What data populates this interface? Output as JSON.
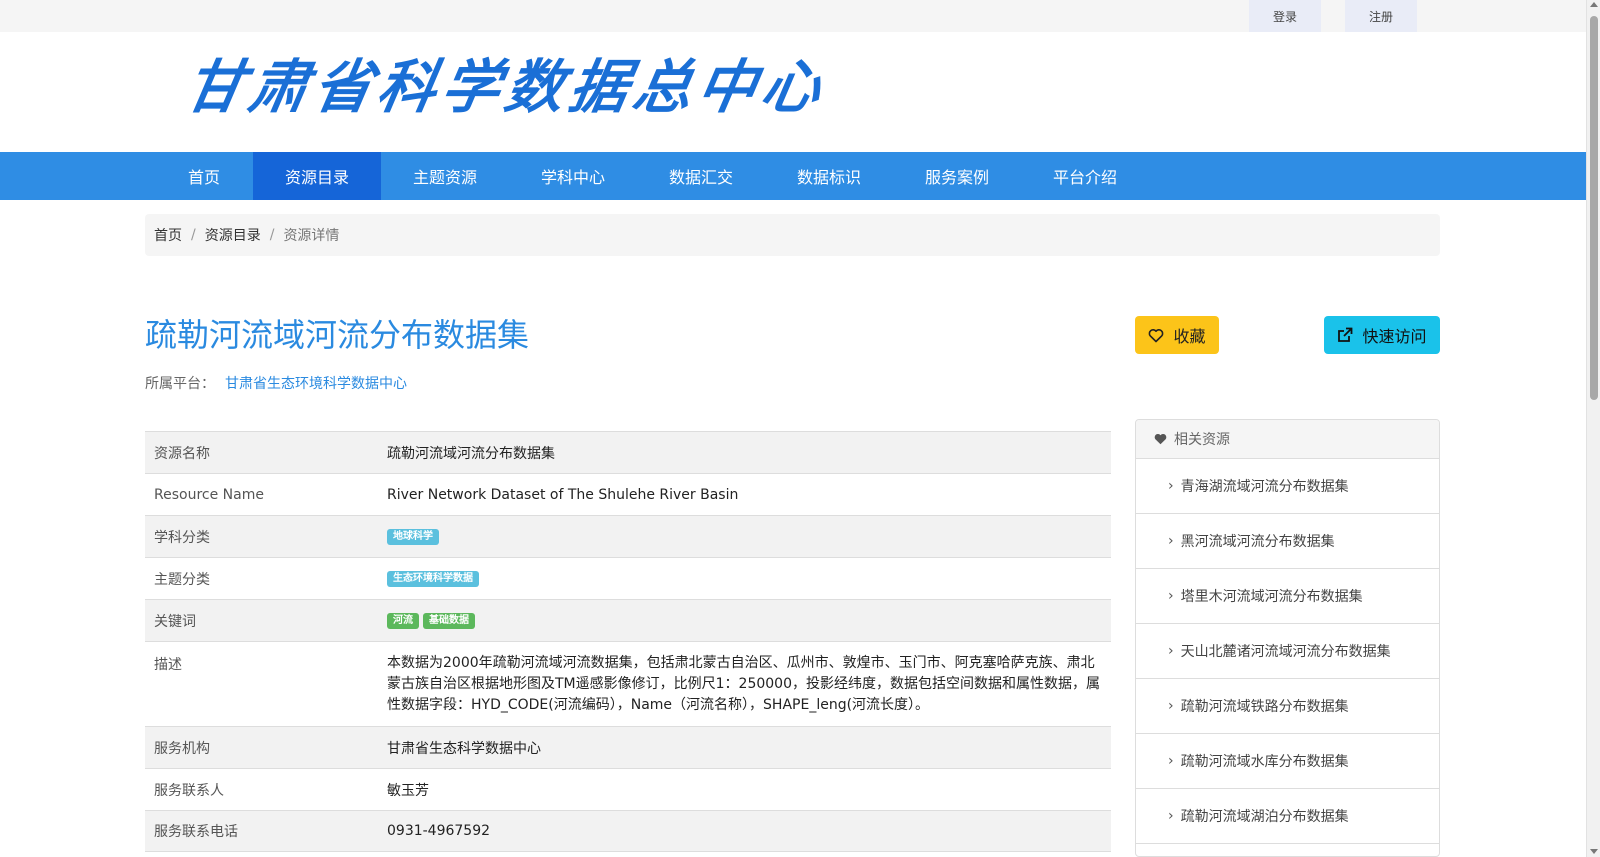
{
  "topbar": {
    "login": "登录",
    "register": "注册"
  },
  "header": {
    "logo_text": "甘肃省科学数据总中心"
  },
  "nav": {
    "items": [
      {
        "label": "首页"
      },
      {
        "label": "资源目录"
      },
      {
        "label": "主题资源"
      },
      {
        "label": "学科中心"
      },
      {
        "label": "数据汇交"
      },
      {
        "label": "数据标识"
      },
      {
        "label": "服务案例"
      },
      {
        "label": "平台介绍"
      }
    ],
    "active": "资源目录"
  },
  "breadcrumb": {
    "home": "首页",
    "catalog": "资源目录",
    "current": "资源详情"
  },
  "resource": {
    "title": "疏勒河流域河流分布数据集",
    "platform_label": "所属平台：",
    "platform_name": "甘肃省生态环境科学数据中心",
    "favorite_label": "收藏",
    "visit_label": "快速访问"
  },
  "info": {
    "name_key": "资源名称",
    "name_val": "疏勒河流域河流分布数据集",
    "ename_key": "Resource Name",
    "ename_val": "River Network Dataset of The Shulehe River Basin",
    "subject_key": "学科分类",
    "subject_tag": "地球科学",
    "topic_key": "主题分类",
    "topic_tag": "生态环境科学数据",
    "keyword_key": "关键词",
    "keyword_tags": [
      "河流",
      "基础数据"
    ],
    "desc_key": "描述",
    "desc_val": "本数据为2000年疏勒河流域河流数据集，包括肃北蒙古自治区、瓜州市、敦煌市、玉门市、阿克塞哈萨克族、肃北蒙古族自治区根据地形图及TM遥感影像修订，比例尺1：250000，投影经纬度，数据包括空间数据和属性数据，属性数据字段：HYD_CODE(河流编码），Name（河流名称），SHAPE_leng(河流长度）。",
    "org_key": "服务机构",
    "org_val": "甘肃省生态科学数据中心",
    "contact_key": "服务联系人",
    "contact_val": "敏玉芳",
    "phone_key": "服务联系电话",
    "phone_val": "0931-4967592"
  },
  "related": {
    "heading": "相关资源",
    "items": [
      "青海湖流域河流分布数据集",
      "黑河流域河流分布数据集",
      "塔里木河流域河流分布数据集",
      "天山北麓诸河流域河流分布数据集",
      "疏勒河流域铁路分布数据集",
      "疏勒河流域水库分布数据集",
      "疏勒河流域湖泊分布数据集"
    ]
  },
  "colors": {
    "nav_bg": "#2f8de4",
    "nav_active": "#1565d8",
    "title": "#2a8ae0",
    "favorite_btn": "#fcc419",
    "visit_btn": "#1ac2ea",
    "tag_info": "#5bc0de",
    "tag_success": "#5cb85c"
  },
  "icons": {
    "favorite": "heart-outline-icon",
    "visit": "external-link-icon",
    "related": "heart-icon",
    "related_item": "chevron-right-icon"
  }
}
